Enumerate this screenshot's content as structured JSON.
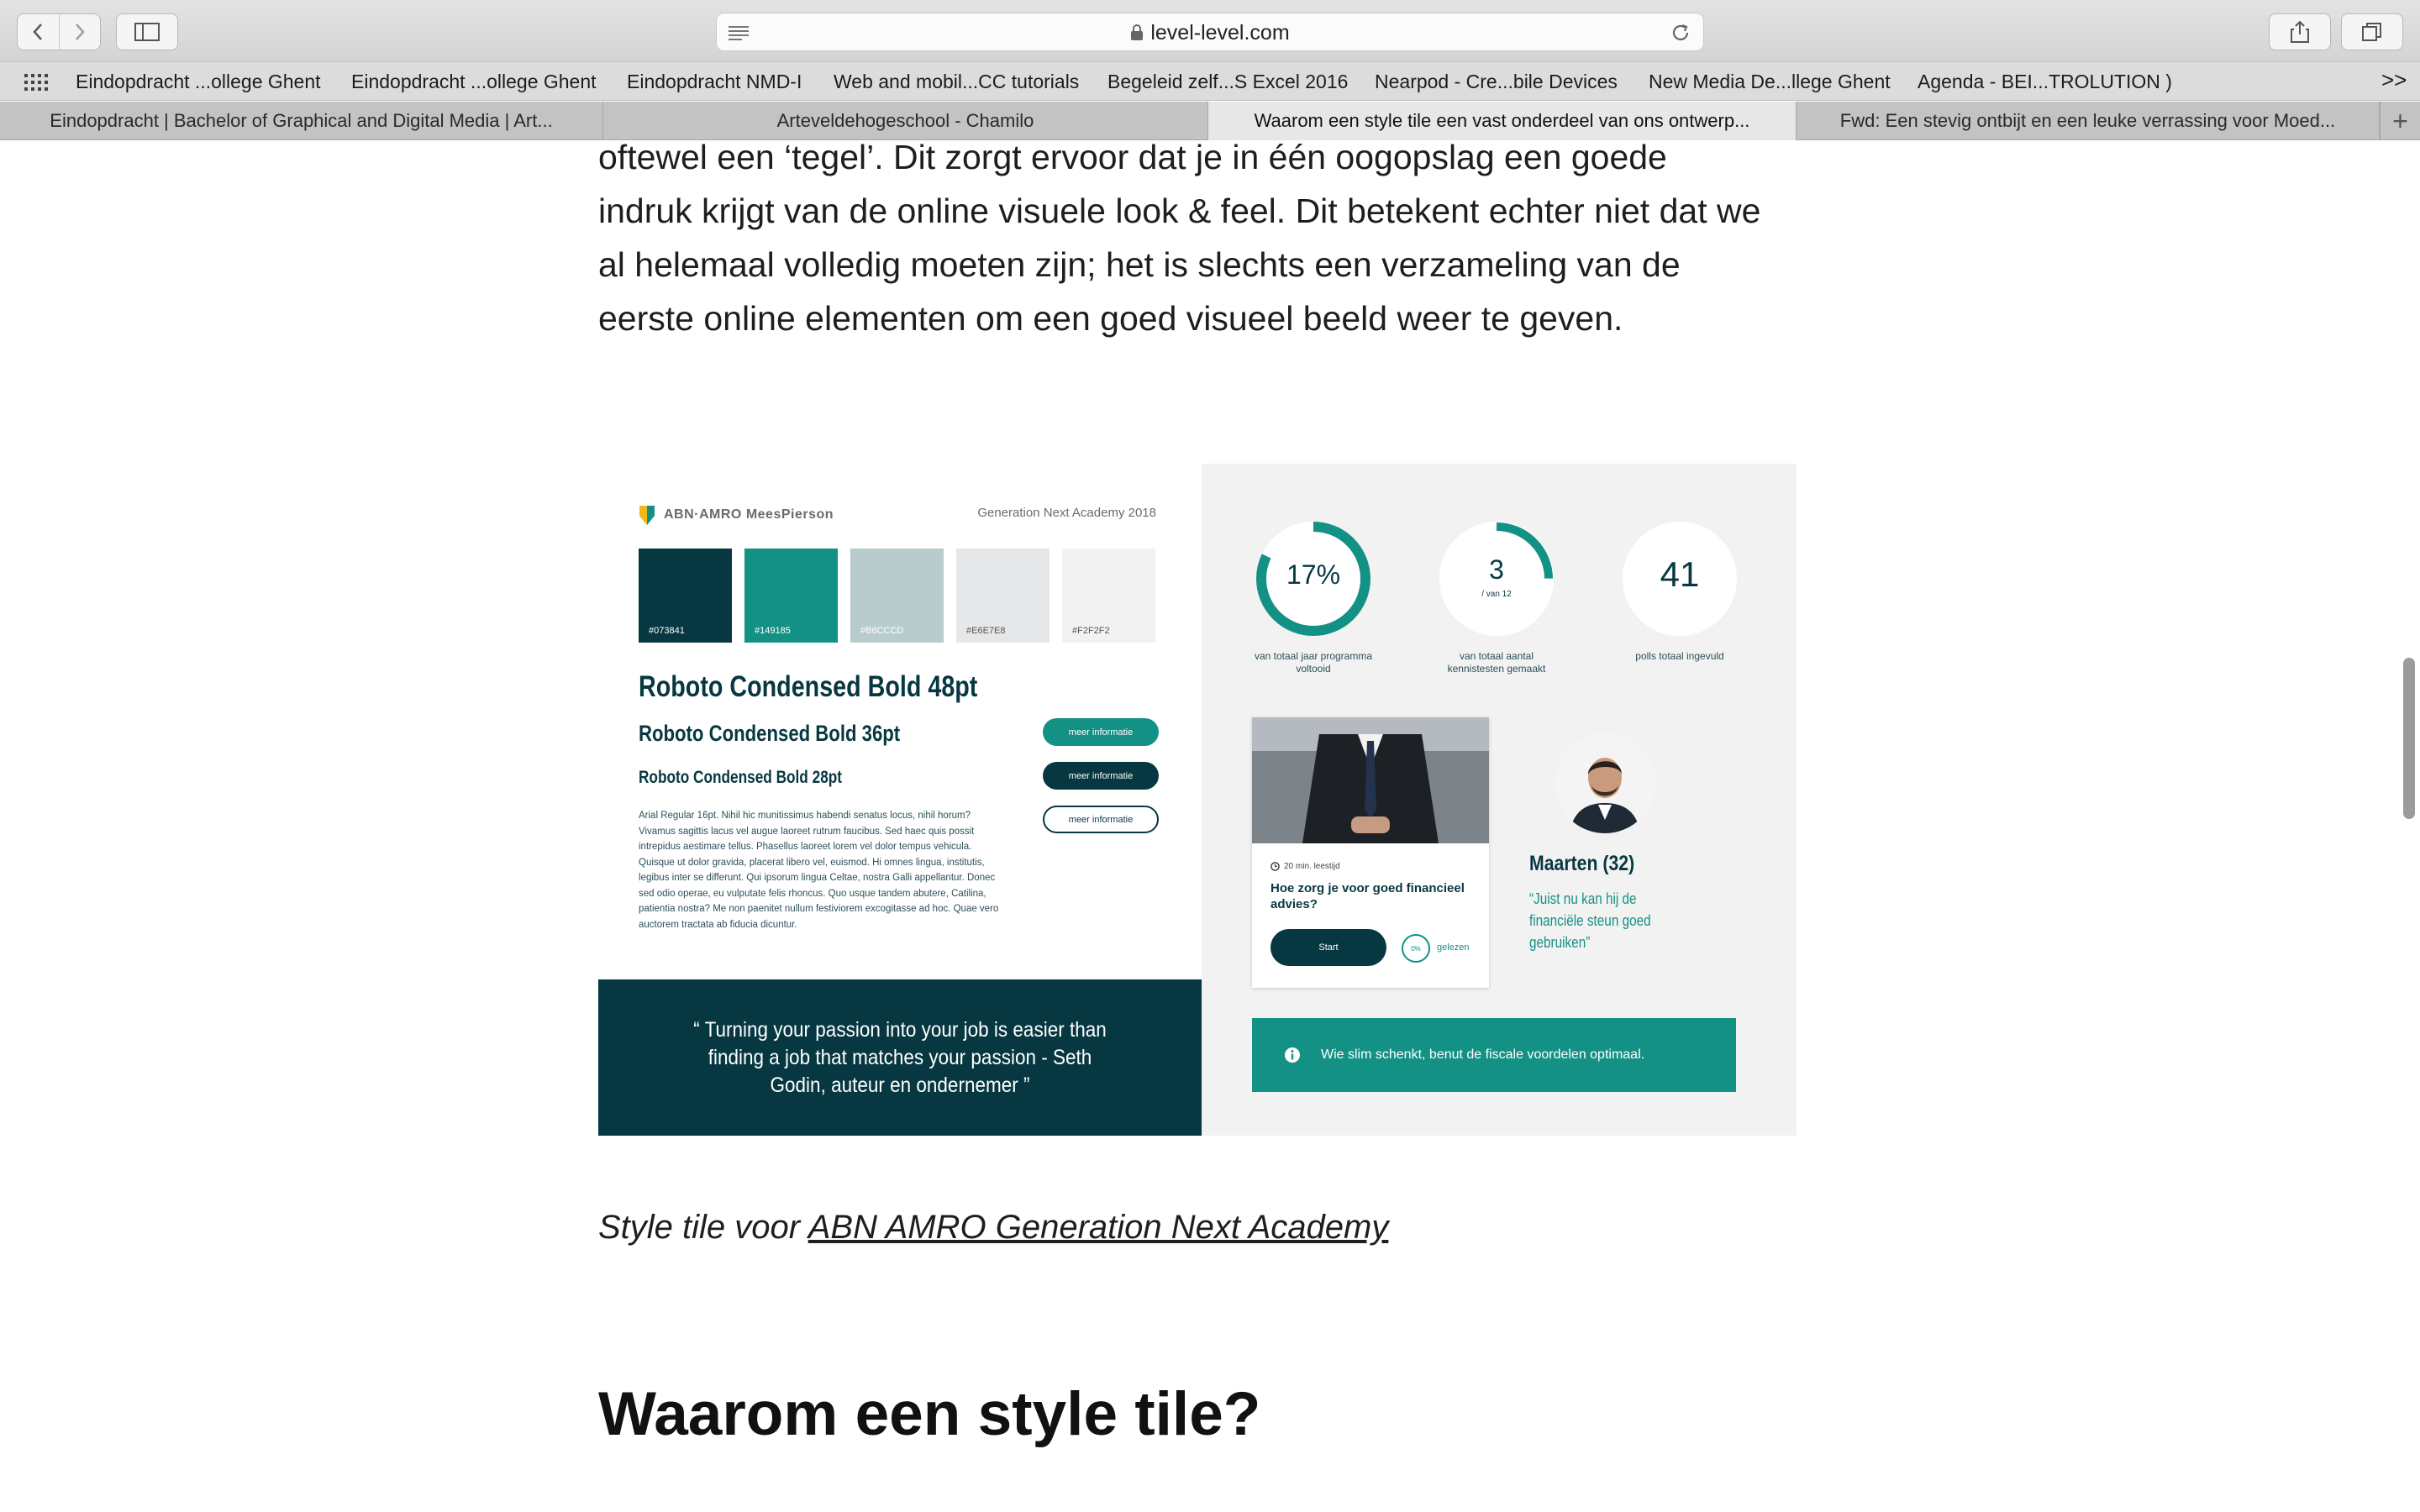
{
  "browser": {
    "url": "level-level.com",
    "bookmarks": [
      "Eindopdracht ...ollege Ghent",
      "Eindopdracht ...ollege Ghent",
      "Eindopdracht NMD-I",
      "Web and mobil...CC tutorials",
      "Begeleid zelf...S Excel 2016",
      "Nearpod - Cre...bile Devices",
      "New Media De...llege Ghent",
      "Agenda - BEI...TROLUTION )"
    ],
    "bookmarks_overflow": ">>",
    "tabs": [
      "Eindopdracht | Bachelor of Graphical and Digital Media | Art...",
      "Arteveldehogeschool - Chamilo",
      "Waarom een style tile een vast onderdeel van ons ontwerp...",
      "Fwd: Een stevig ontbijt en een leuke verrassing voor Moed..."
    ],
    "active_tab_index": 2,
    "new_tab": "+"
  },
  "article": {
    "intro_lines": [
      "oftewel een ‘tegel’. Dit zorgt ervoor dat je in één oogopslag een goede",
      "indruk krijgt van de online visuele look & feel. Dit betekent echter niet dat we",
      "al helemaal volledig moeten zijn; het is slechts een verzameling van de",
      "eerste online elementen om een goed visueel beeld weer te geven."
    ],
    "caption_prefix": "Style tile voor ",
    "caption_link": "ABN AMRO Generation Next Academy",
    "heading": "Waarom een style tile?"
  },
  "tile": {
    "logo_text": "ABN·AMRO MeesPierson",
    "program": "Generation Next Academy 2018",
    "swatches": [
      {
        "hex": "#073841",
        "label": "#073841"
      },
      {
        "hex": "#149185",
        "label": "#149185"
      },
      {
        "hex": "#B8CCCD",
        "label": "#B8CCCD"
      },
      {
        "hex": "#E6E7E8",
        "label": "#E6E7E8"
      },
      {
        "hex": "#F2F2F2",
        "label": "#F2F2F2"
      }
    ],
    "heading_48": "Roboto Condensed Bold 48pt",
    "heading_36": "Roboto Condensed Bold 36pt",
    "heading_28": "Roboto Condensed Bold 28pt",
    "body_text": "Arial Regular 16pt. Nihil hic munitissimus habendi senatus locus, nihil horum? Vivamus sagittis lacus vel augue laoreet rutrum faucibus. Sed haec quis possit intrepidus aestimare tellus. Phasellus laoreet lorem vel dolor tempus vehicula. Quisque ut dolor gravida, placerat libero vel, euismod. Hi omnes lingua, institutis, legibus inter se differunt. Qui ipsorum lingua Celtae, nostra Galli appellantur. Donec sed odio operae, eu vulputate felis rhoncus. Quo usque tandem abutere, Catilina, patientia nostra? Me non paenitet nullum festiviorem excogitasse ad hoc. Quae vero auctorem tractata ab fiducia dicuntur.",
    "buttons": [
      "meer informatie",
      "meer informatie",
      "meer informatie"
    ],
    "quote": "“ Turning your passion into your job is easier than finding a job that matches your passion - Seth Godin, auteur en ondernemer ”",
    "stats": [
      {
        "value": "17%",
        "sub": "",
        "caption": "van totaal jaar programma voltooid",
        "progress": 0.17
      },
      {
        "value": "3",
        "sub": "/ van 12",
        "caption": "van totaal aantal kennistesten gemaakt",
        "progress": 0.25
      },
      {
        "value": "41",
        "sub": "",
        "caption": "polls totaal ingevuld",
        "progress": 0
      }
    ],
    "card": {
      "meta": "20 min. leestijd",
      "title": "Hoe zorg je voor goed financieel advies?",
      "start": "Start",
      "progress_label": "0%",
      "read_label": "gelezen"
    },
    "person": {
      "name": "Maarten (32)",
      "quote": "“Juist nu kan hij de financiële steun goed gebruiken”"
    },
    "info": "Wie slim schenkt, benut de fiscale voordelen optimaal.",
    "colors": {
      "dark": "#073841",
      "accent": "#149185"
    }
  }
}
